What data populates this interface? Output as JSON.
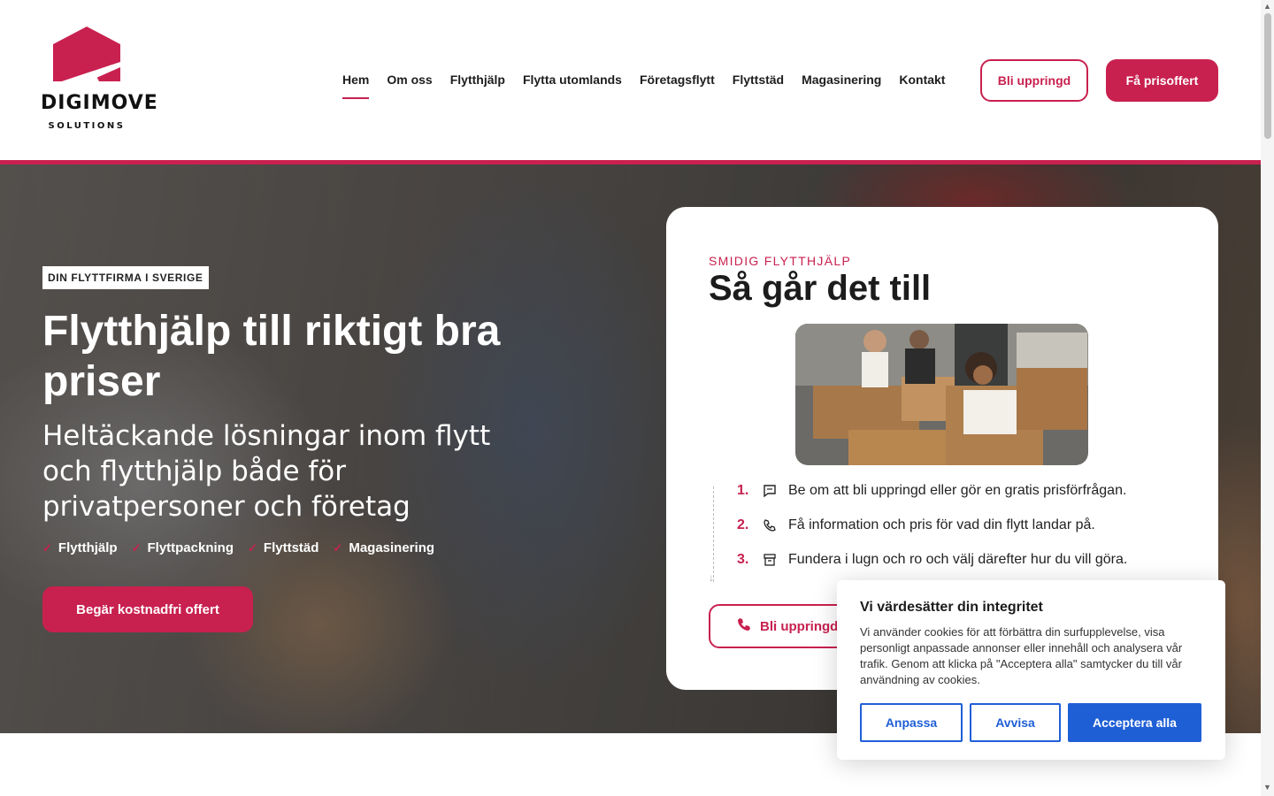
{
  "brand": {
    "name": "DIGIMOVE",
    "tagline": "SOLUTIONS",
    "accent": "#c8214f",
    "cookie_blue": "#1f5fd6"
  },
  "nav": {
    "items": [
      {
        "label": "Hem",
        "active": true
      },
      {
        "label": "Om oss"
      },
      {
        "label": "Flytthjälp"
      },
      {
        "label": "Flytta utomlands"
      },
      {
        "label": "Företagsflytt"
      },
      {
        "label": "Flyttstäd"
      },
      {
        "label": "Magasinering"
      },
      {
        "label": "Kontakt"
      }
    ],
    "callback_button": "Bli uppringd",
    "quote_button": "Få prisoffert"
  },
  "hero": {
    "badge": "DIN FLYTTFIRMA I SVERIGE",
    "title": "Flytthjälp till riktigt bra priser",
    "subtitle": "Heltäckande lösningar inom flytt och flytthjälp både för privatpersoner och företag",
    "tags": [
      "Flytthjälp",
      "Flyttpackning",
      "Flyttstäd",
      "Magasinering"
    ],
    "cta": "Begär kostnadfri offert"
  },
  "card": {
    "kicker": "SMIDIG FLYTTHJÄLP",
    "title": "Så går det till",
    "steps": [
      {
        "num": "1.",
        "icon": "chat-icon",
        "text": "Be om att bli uppringd eller gör en gratis prisförfrågan."
      },
      {
        "num": "2.",
        "icon": "phone-icon",
        "text": "Få information och pris för vad din flytt landar på."
      },
      {
        "num": "3.",
        "icon": "archive-icon",
        "text": "Fundera i lugn och ro och välj därefter hur du vill göra."
      }
    ],
    "button": "Bli uppringd"
  },
  "cookie": {
    "title": "Vi värdesätter din integritet",
    "text": "Vi använder cookies för att förbättra din surfupplevelse, visa personligt anpassade annonser eller innehåll och analysera vår trafik. Genom att klicka på \"Acceptera alla\" samtycker du till vår användning av cookies.",
    "customize": "Anpassa",
    "reject": "Avvisa",
    "accept": "Acceptera alla"
  }
}
